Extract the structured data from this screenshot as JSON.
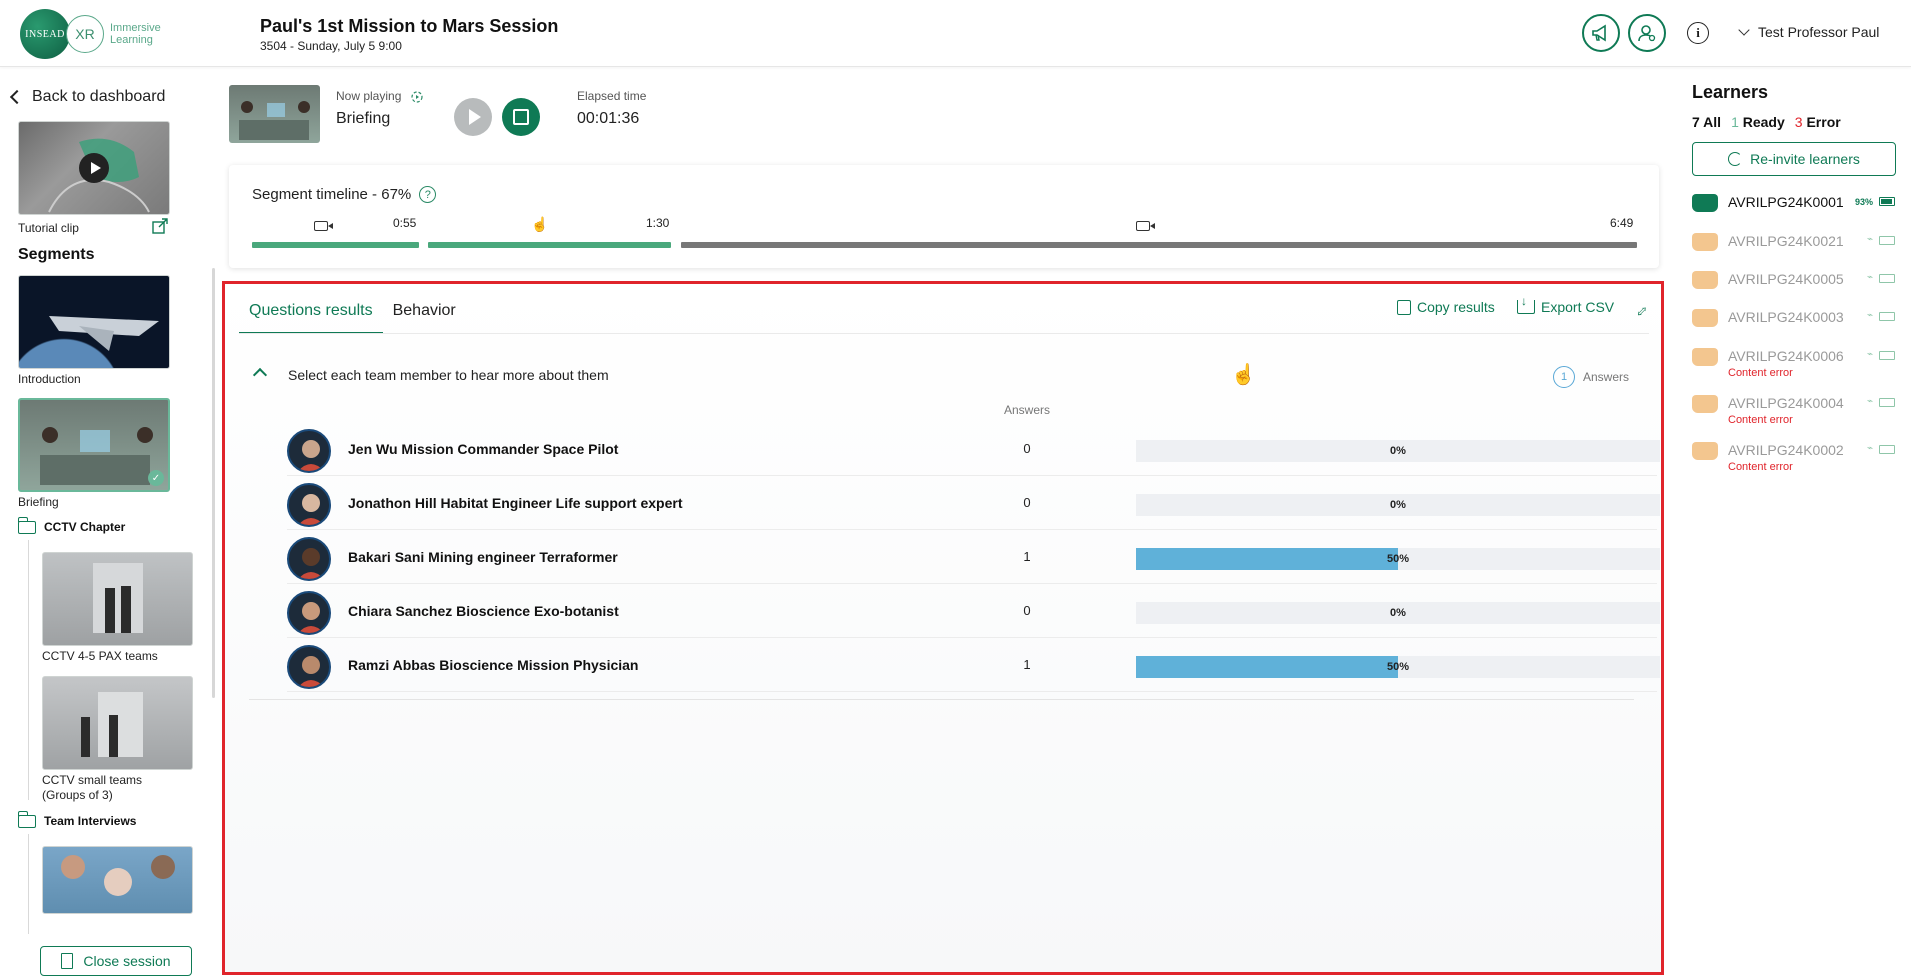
{
  "header": {
    "logo_brand": "INSEAD",
    "logo_xr": "XR",
    "logo_text_line1": "Immersive",
    "logo_text_line2": "Learning",
    "session_title": "Paul's 1st Mission to Mars Session",
    "session_subtitle": "3504 - Sunday, July 5  9:00",
    "user_name": "Test Professor Paul",
    "icons": [
      "megaphone-icon",
      "user-settings-icon",
      "info-icon",
      "chevron-down-icon"
    ]
  },
  "sidebar": {
    "back_label": "Back to dashboard",
    "tutorial_label": "Tutorial clip",
    "segments_title": "Segments",
    "segments": [
      {
        "label": "Introduction"
      },
      {
        "label": "Briefing"
      }
    ],
    "chapters": [
      {
        "label": "CCTV Chapter",
        "items": [
          {
            "label": "CCTV 4-5 PAX teams"
          },
          {
            "label": "CCTV small teams (Groups of 3)"
          }
        ]
      },
      {
        "label": "Team Interviews",
        "items": []
      }
    ],
    "close_label": "Close session"
  },
  "now_playing": {
    "label": "Now playing",
    "value": "Briefing",
    "elapsed_label": "Elapsed time",
    "elapsed_value": "00:01:36"
  },
  "timeline": {
    "title": "Segment timeline - 67%",
    "progress_percent": 67,
    "marks": [
      "0:55",
      "1:30",
      "6:49"
    ],
    "help_symbol": "?"
  },
  "results": {
    "tabs": [
      {
        "label": "Questions results",
        "active": true
      },
      {
        "label": "Behavior",
        "active": false
      }
    ],
    "copy_label": "Copy results",
    "export_label": "Export CSV",
    "question": "Select each team member to hear more about them",
    "answer_total": "1",
    "answers_label": "Answers",
    "column_header": "Answers",
    "rows": [
      {
        "name": "Jen Wu Mission Commander Space Pilot",
        "count": "0",
        "percent": 0,
        "percent_label": "0%"
      },
      {
        "name": "Jonathon Hill Habitat Engineer Life support expert",
        "count": "0",
        "percent": 0,
        "percent_label": "0%"
      },
      {
        "name": "Bakari Sani Mining engineer Terraformer",
        "count": "1",
        "percent": 50,
        "percent_label": "50%"
      },
      {
        "name": "Chiara Sanchez Bioscience Exo-botanist",
        "count": "0",
        "percent": 0,
        "percent_label": "0%"
      },
      {
        "name": "Ramzi Abbas Bioscience Mission Physician",
        "count": "1",
        "percent": 50,
        "percent_label": "50%"
      }
    ]
  },
  "learners": {
    "title": "Learners",
    "all_count": "7",
    "all_label": "All",
    "ready_count": "1",
    "ready_label": "Ready",
    "error_count": "3",
    "error_label": "Error",
    "reinvite_label": "Re-invite learners",
    "list": [
      {
        "id": "AVRILPG24K0001",
        "status": "ready",
        "battery": "93%",
        "sub": ""
      },
      {
        "id": "AVRILPG24K0021",
        "status": "waiting",
        "battery": "",
        "sub": ""
      },
      {
        "id": "AVRILPG24K0005",
        "status": "waiting",
        "battery": "",
        "sub": ""
      },
      {
        "id": "AVRILPG24K0003",
        "status": "waiting",
        "battery": "",
        "sub": ""
      },
      {
        "id": "AVRILPG24K0006",
        "status": "error",
        "battery": "",
        "sub": "Content error"
      },
      {
        "id": "AVRILPG24K0004",
        "status": "error",
        "battery": "",
        "sub": "Content error"
      },
      {
        "id": "AVRILPG24K0002",
        "status": "error",
        "battery": "",
        "sub": "Content error"
      }
    ]
  },
  "colors": {
    "brand": "#0f7a55",
    "error": "#e0242b",
    "bar": "#5fb1d9",
    "highlight_border": "#e0242b"
  }
}
